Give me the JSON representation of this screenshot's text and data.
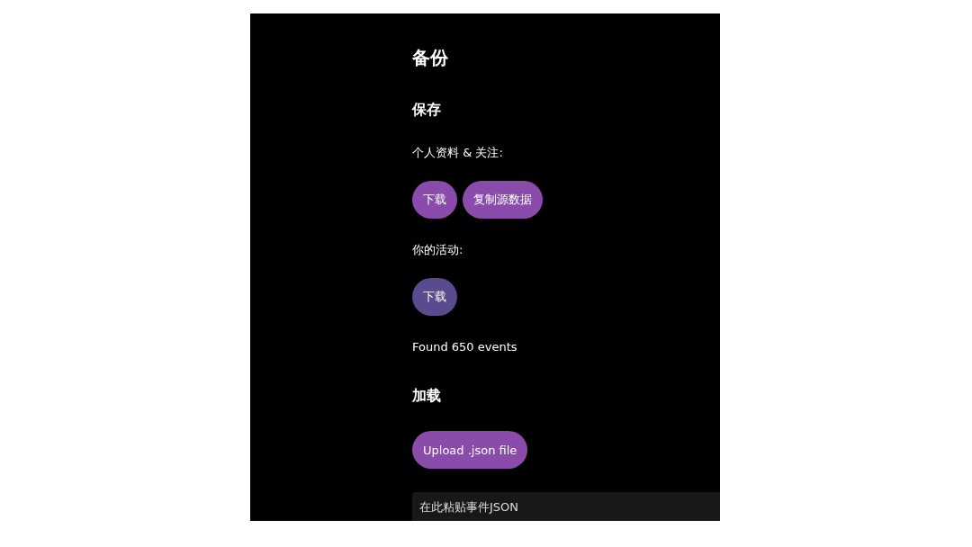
{
  "title": "备份",
  "sections": [
    {
      "heading": "保存",
      "items": [
        {
          "kind": "label",
          "text": "个人资料 & 关注:"
        },
        {
          "kind": "buttons",
          "buttons": [
            {
              "label": "下载",
              "hovered": false
            },
            {
              "label": "复制源数据",
              "hovered": false
            }
          ]
        },
        {
          "kind": "label",
          "text": "你的活动:"
        },
        {
          "kind": "buttons",
          "buttons": [
            {
              "label": "下载",
              "hovered": true
            }
          ]
        },
        {
          "kind": "label",
          "text": "Found 650 events"
        }
      ]
    },
    {
      "heading": "加载",
      "items": [
        {
          "kind": "buttons",
          "buttons": [
            {
              "label": "Upload .json file",
              "hovered": false
            }
          ]
        },
        {
          "kind": "textarea",
          "placeholder": "在此粘贴事件JSON"
        }
      ]
    }
  ]
}
